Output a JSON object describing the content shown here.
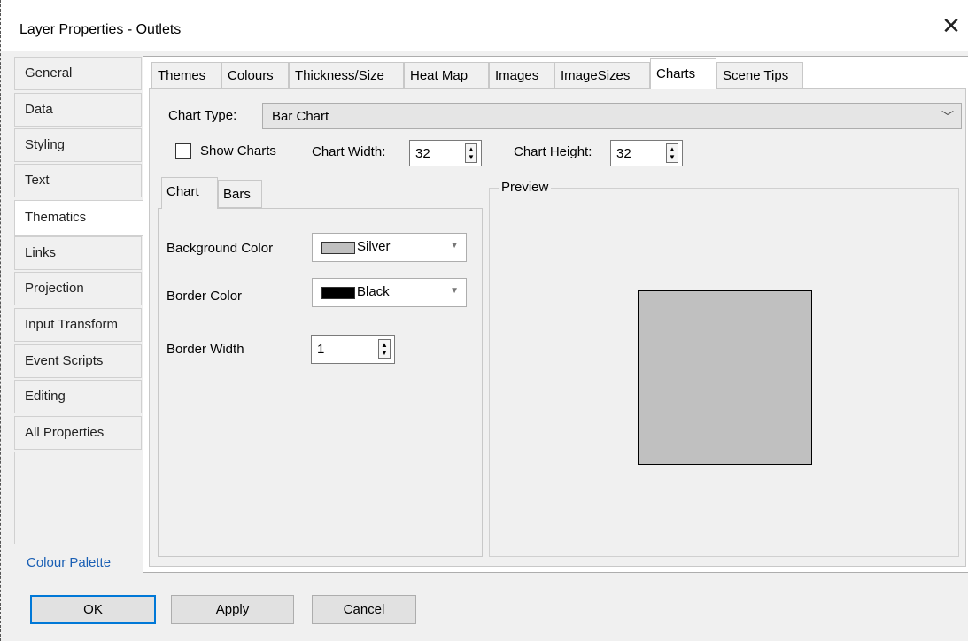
{
  "window": {
    "title": "Layer Properties - Outlets",
    "close_symbol": "✕"
  },
  "nav": {
    "items": [
      {
        "label": "General"
      },
      {
        "label": "Data"
      },
      {
        "label": "Styling"
      },
      {
        "label": "Text"
      },
      {
        "label": "Thematics",
        "active": true
      },
      {
        "label": "Links"
      },
      {
        "label": "Projection"
      },
      {
        "label": "Input Transform"
      },
      {
        "label": "Event Scripts"
      },
      {
        "label": "Editing"
      },
      {
        "label": "All Properties"
      }
    ],
    "palette_link": "Colour Palette"
  },
  "tabs": [
    {
      "label": "Themes"
    },
    {
      "label": "Colours"
    },
    {
      "label": "Thickness/Size"
    },
    {
      "label": "Heat Map"
    },
    {
      "label": "Images"
    },
    {
      "label": "ImageSizes"
    },
    {
      "label": "Charts",
      "active": true
    },
    {
      "label": "Scene Tips"
    }
  ],
  "charts": {
    "chart_type_label": "Chart Type:",
    "chart_type_value": "Bar Chart",
    "show_charts_label": "Show Charts",
    "show_charts_checked": false,
    "chart_width_label": "Chart Width:",
    "chart_width_value": "32",
    "chart_height_label": "Chart Height:",
    "chart_height_value": "32"
  },
  "inner_tabs": [
    {
      "label": "Chart",
      "active": true
    },
    {
      "label": "Bars"
    }
  ],
  "chart_tab": {
    "background_color_label": "Background Color",
    "background_color_name": "Silver",
    "background_color_hex": "#c0c0c0",
    "border_color_label": "Border Color",
    "border_color_name": "Black",
    "border_color_hex": "#000000",
    "border_width_label": "Border Width",
    "border_width_value": "1"
  },
  "preview": {
    "legend": "Preview",
    "fill": "#c0c0c0",
    "stroke": "#000000"
  },
  "buttons": {
    "ok": "OK",
    "apply": "Apply",
    "cancel": "Cancel"
  },
  "colors": {
    "accent": "#0078d7",
    "link": "#1a5fb4"
  }
}
